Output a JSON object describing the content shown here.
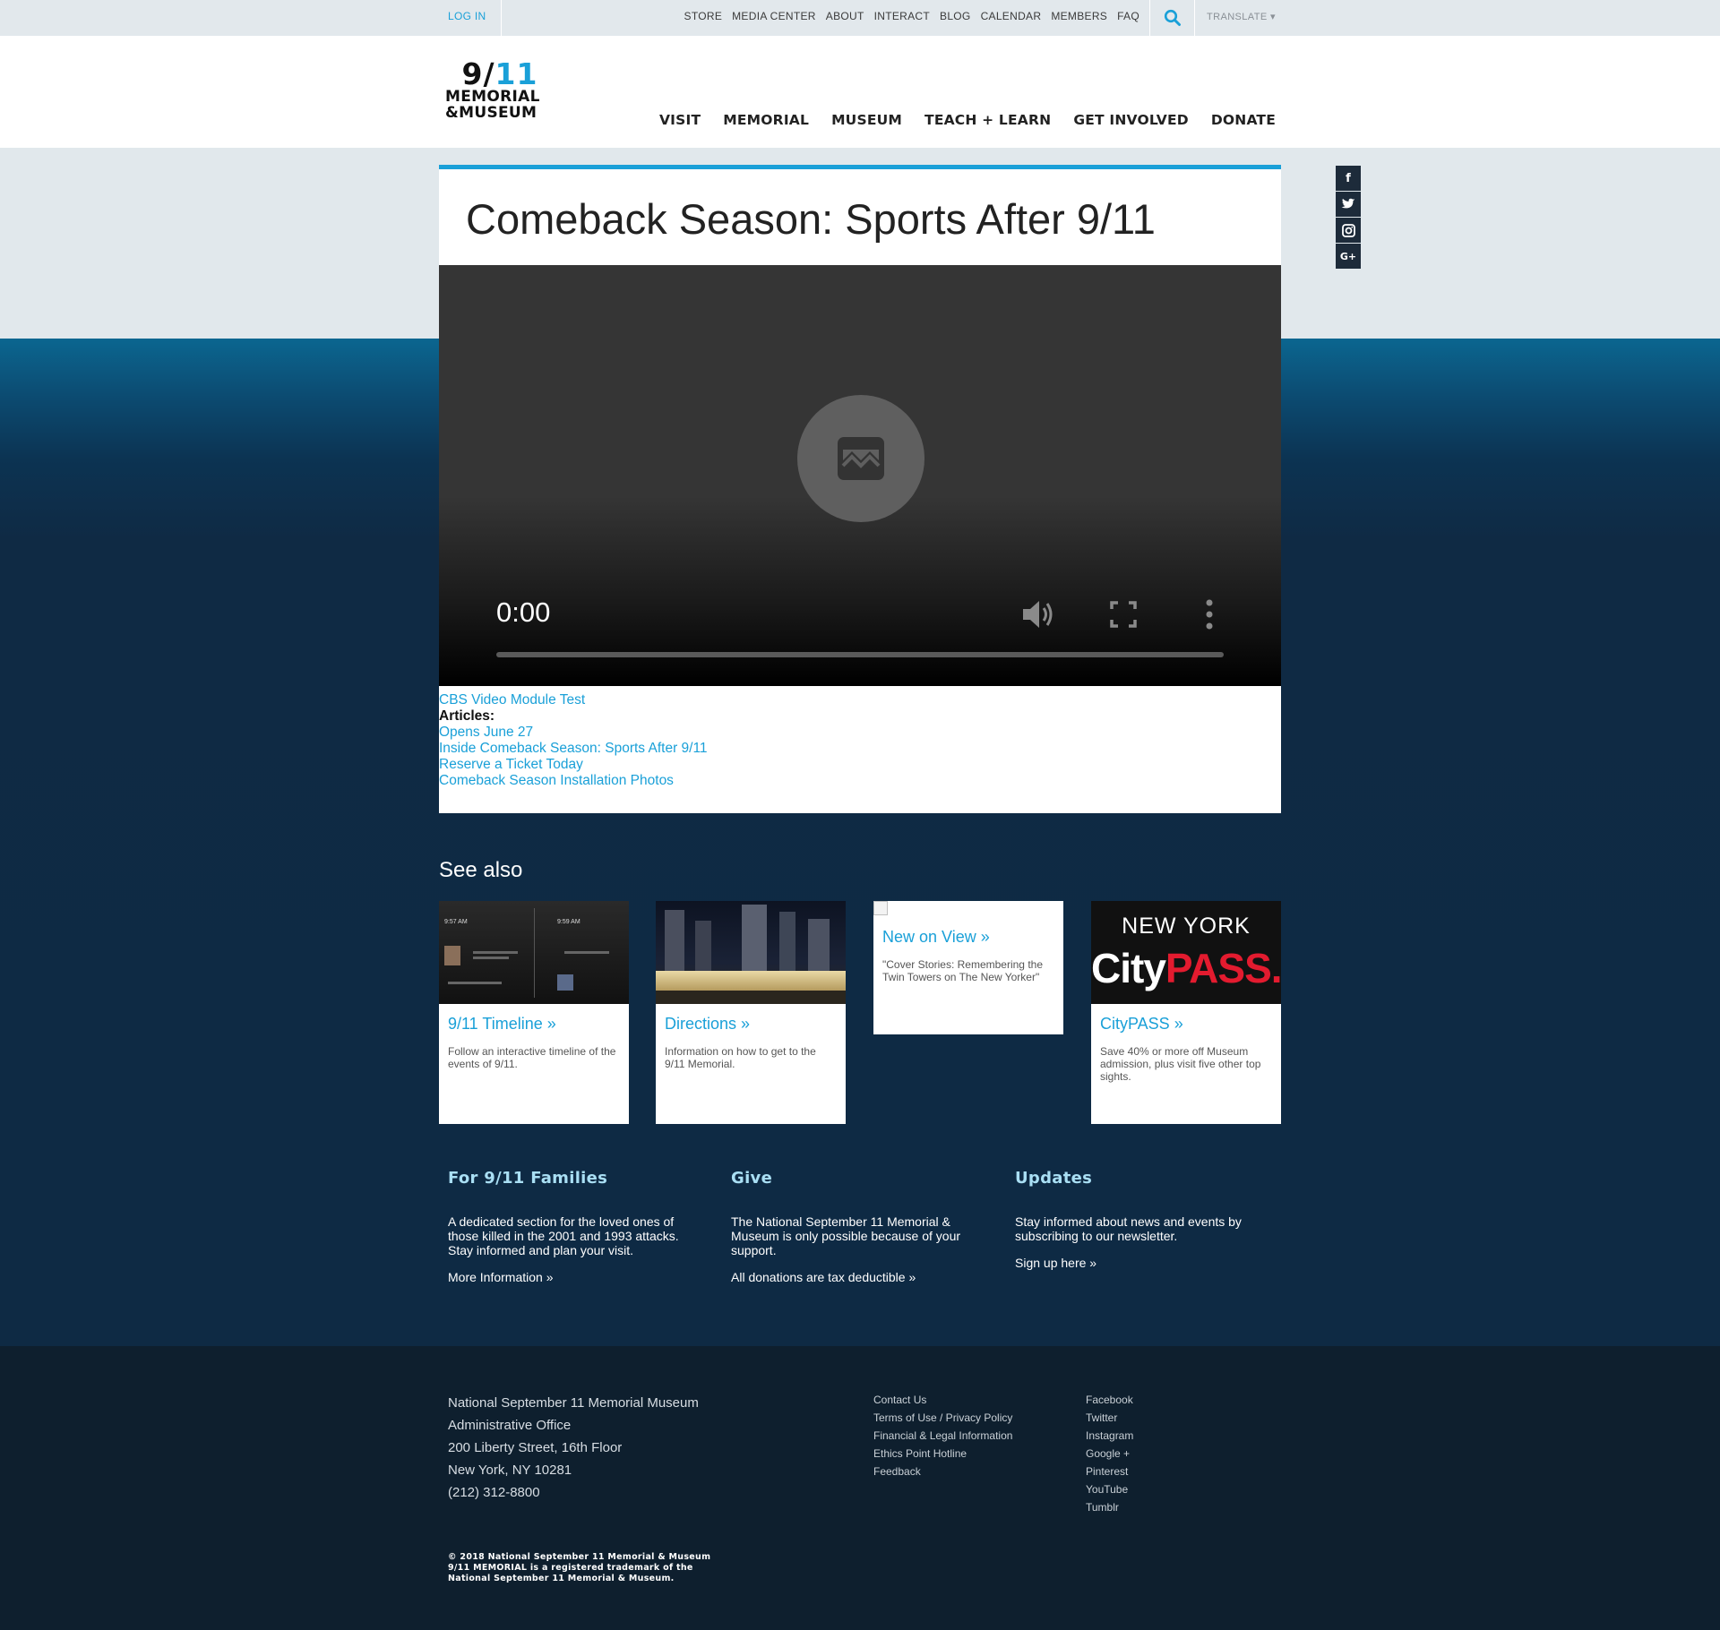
{
  "utility": {
    "login": "LOG IN",
    "links": [
      "STORE",
      "MEDIA CENTER",
      "ABOUT",
      "INTERACT",
      "BLOG",
      "CALENDAR",
      "MEMBERS",
      "FAQ"
    ],
    "translate": "TRANSLATE ▾"
  },
  "logo": {
    "nine": "9",
    "slash": "/",
    "eleven": "11",
    "line1": "MEMORIAL",
    "line2": "&MUSEUM"
  },
  "nav": [
    "VISIT",
    "MEMORIAL",
    "MUSEUM",
    "TEACH + LEARN",
    "GET INVOLVED",
    "DONATE"
  ],
  "article": {
    "title": "Comeback Season: Sports After 9/11",
    "video": {
      "time": "0:00"
    },
    "video_link": "CBS Video Module Test",
    "articles_label": "Articles:",
    "articles": [
      "Opens June 27",
      "Inside Comeback Season: Sports After 9/11",
      "Reserve a Ticket Today",
      "Comeback Season Installation Photos"
    ]
  },
  "social": [
    "f",
    "t",
    "i",
    "G+"
  ],
  "see_also": {
    "title": "See also",
    "tiles": [
      {
        "title": "9/11 Timeline »",
        "desc": "Follow an interactive timeline of the events of 9/11.",
        "img_times": [
          "9:57 AM",
          "9:59 AM"
        ]
      },
      {
        "title": "Directions »",
        "desc": "Information on how to get to the 9/11 Memorial."
      },
      {
        "title": "New on View »",
        "desc": "\"Cover Stories: Remembering the Twin Towers on The New Yorker\""
      },
      {
        "title": "CityPASS »",
        "desc": "Save 40% or more off Museum admission, plus visit five other top sights.",
        "img_top": "NEW YORK",
        "img_city": "City",
        "img_pass": "PASS."
      }
    ]
  },
  "columns": [
    {
      "title": "For 9/11 Families",
      "text": "A dedicated section for the loved ones of those killed in the 2001 and 1993 attacks. Stay informed and plan your visit.",
      "link": "More Information »"
    },
    {
      "title": "Give",
      "text": "The National September 11 Memorial & Museum is only possible because of your support.",
      "link": "All donations are tax deductible »"
    },
    {
      "title": "Updates",
      "text": "Stay informed about news and events by subscribing to our newsletter.",
      "link": "Sign up here »"
    }
  ],
  "footer": {
    "address": [
      "National September 11 Memorial Museum",
      "Administrative Office",
      "200 Liberty Street, 16th Floor",
      "New York, NY 10281",
      "(212) 312-8800"
    ],
    "links": [
      "Contact Us",
      "Terms of Use / Privacy Policy",
      "Financial & Legal Information",
      "Ethics Point Hotline",
      "Feedback"
    ],
    "social": [
      "Facebook",
      "Twitter",
      "Instagram",
      "Google +",
      "Pinterest",
      "YouTube",
      "Tumblr"
    ],
    "copyright": [
      "© 2018 National September 11 Memorial & Museum",
      "9/11 MEMORIAL is a registered trademark of the",
      "National September 11 Memorial & Museum."
    ]
  }
}
